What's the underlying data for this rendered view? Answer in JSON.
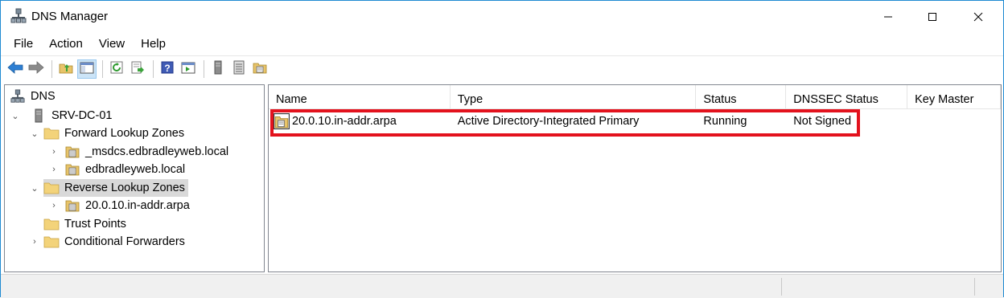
{
  "window": {
    "title": "DNS Manager"
  },
  "menu": [
    "File",
    "Action",
    "View",
    "Help"
  ],
  "toolbar": {
    "buttons": [
      "back-icon",
      "forward-icon",
      "up-folder-icon",
      "show-hide-console-tree-icon",
      "refresh-icon",
      "export-list-icon",
      "help-icon",
      "action-pane-icon",
      "server-icon",
      "list-view-icon",
      "zone-icon"
    ]
  },
  "tree": {
    "root": "DNS",
    "server": "SRV-DC-01",
    "forward_zones": "Forward Lookup Zones",
    "forward_children": [
      "_msdcs.edbradleyweb.local",
      "edbradleyweb.local"
    ],
    "reverse_zones": "Reverse Lookup Zones",
    "reverse_children": [
      "20.0.10.in-addr.arpa"
    ],
    "trust_points": "Trust Points",
    "conditional_forwarders": "Conditional Forwarders"
  },
  "list": {
    "columns": [
      "Name",
      "Type",
      "Status",
      "DNSSEC Status",
      "Key Master"
    ],
    "rows": [
      {
        "name": "20.0.10.in-addr.arpa",
        "type": "Active Directory-Integrated Primary",
        "status": "Running",
        "dnssec": "Not Signed",
        "key_master": ""
      }
    ]
  },
  "colors": {
    "highlight": "#e3121d",
    "accent": "#1f8ad2"
  }
}
